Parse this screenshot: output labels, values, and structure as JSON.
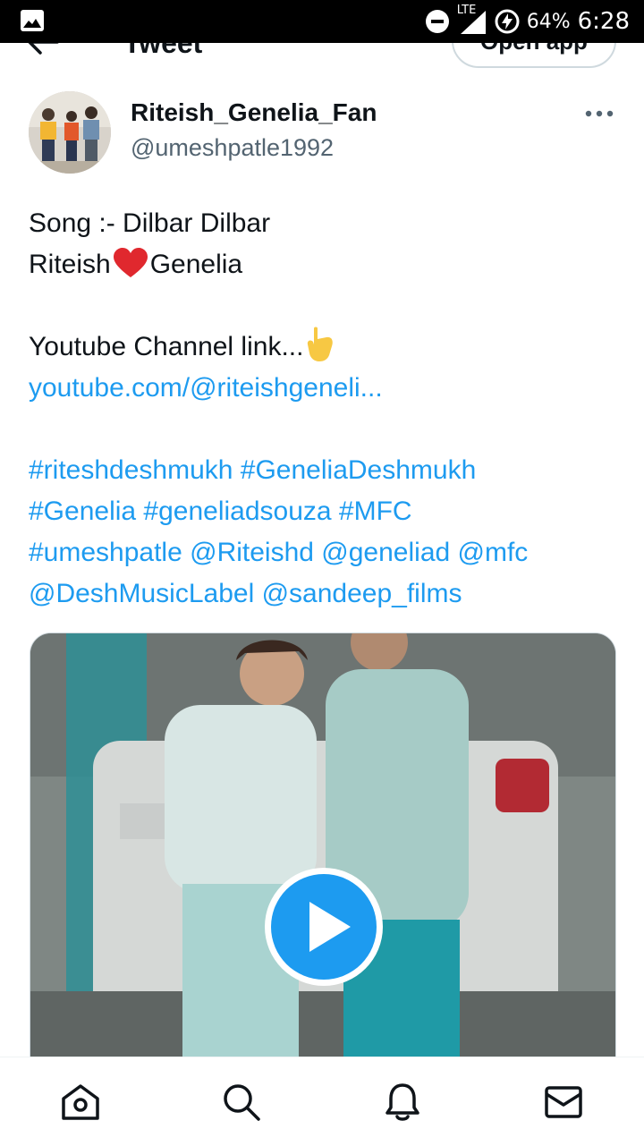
{
  "status_bar": {
    "network": "LTE",
    "battery": "64%",
    "time": "6:28"
  },
  "header": {
    "title": "Tweet",
    "open_app_label": "Open app"
  },
  "author": {
    "display_name": "Riteish_Genelia_Fan",
    "handle": "@umeshpatle1992"
  },
  "tweet": {
    "line1": "Song :- Dilbar Dilbar",
    "line2_left": "Riteish",
    "line2_right": "Genelia",
    "line3": "Youtube Channel link...",
    "link": "youtube.com/@riteishgeneli...",
    "tags_line1": "#riteshdeshmukh #GeneliaDeshmukh",
    "tags_line2": "#Genelia #geneliadsouza #MFC",
    "tags_line3": "#umeshpatle @Riteishd @geneliad @mfc",
    "tags_line4": "@DeshMusicLabel @sandeep_films",
    "link_color": "#1d9bf0"
  },
  "media": {
    "type": "video",
    "play_button_color": "#1d9bf0"
  },
  "bottom_nav": {
    "items": [
      "home-icon",
      "search-icon",
      "notifications-icon",
      "messages-icon"
    ]
  }
}
